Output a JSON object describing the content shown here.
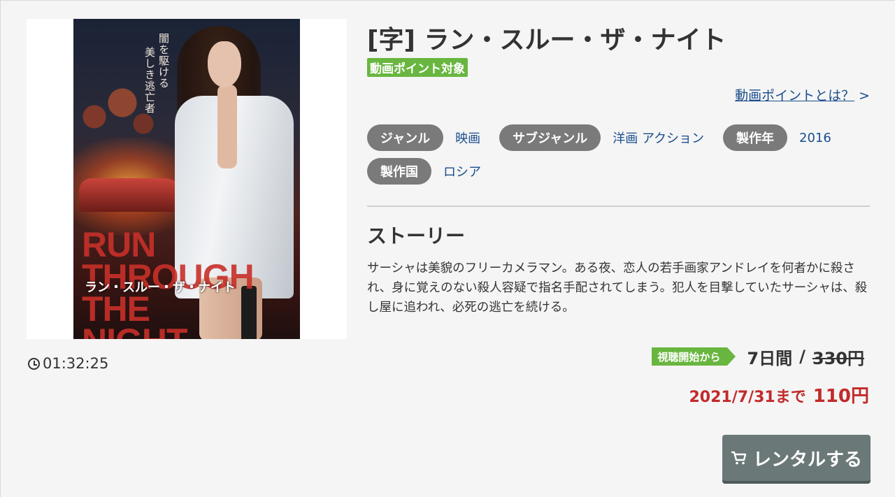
{
  "title": "[字] ラン・スルー・ザ・ナイト",
  "point_badge": "動画ポイント対象",
  "point_link": "動画ポイントとは？",
  "point_link_arrow": ">",
  "poster": {
    "vertical_text_1": "闇を駆ける",
    "vertical_text_2": "美しき逃亡者",
    "title_en": "RUN THROUGH THE NIGHT",
    "title_jp": "ラン・スルー・ザ・ナイト"
  },
  "duration": "01:32:25",
  "tags": [
    {
      "label": "ジャンル",
      "value": "映画"
    },
    {
      "label": "サブジャンル",
      "value": "洋画 アクション"
    },
    {
      "label": "製作年",
      "value": "2016"
    },
    {
      "label": "製作国",
      "value": "ロシア"
    }
  ],
  "story": {
    "heading": "ストーリー",
    "body": "サーシャは美貌のフリーカメラマン。ある夜、恋人の若手画家アンドレイを何者かに殺され、身に覚えのない殺人容疑で指名手配されてしまう。犯人を目撃していたサーシャは、殺し屋に追われ、必死の逃亡を続ける。"
  },
  "pricing": {
    "badge": "視聴開始から",
    "period": "7日間",
    "separator": "/",
    "original_price": "330円",
    "sale_until": "2021/7/31まで",
    "sale_price": "110円"
  },
  "rent_button": "レンタルする",
  "colors": {
    "accent_green": "#68b63f",
    "link_blue": "#1a4d8c",
    "sale_red": "#c22a2a",
    "button_gray": "#6b7878"
  }
}
